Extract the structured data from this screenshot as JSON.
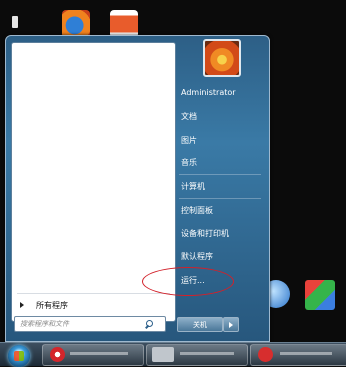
{
  "user": {
    "name": "Administrator"
  },
  "menu": {
    "right_items": [
      {
        "label": "文档"
      },
      {
        "label": "图片"
      },
      {
        "label": "音乐"
      },
      {
        "label": "计算机"
      },
      {
        "label": "控制面板"
      },
      {
        "label": "设备和打印机"
      },
      {
        "label": "默认程序"
      },
      {
        "label": "运行..."
      }
    ],
    "all_programs": "所有程序",
    "search_placeholder": "搜索程序和文件",
    "shutdown_label": "关机"
  },
  "icons": {
    "start": "windows-start-orb-icon",
    "search": "search-icon",
    "all_programs": "triangle-right-icon",
    "shutdown_arrow": "triangle-right-icon"
  },
  "colors": {
    "menu_right_bg": "#3a7aa6",
    "left_pane_bg": "#ffffff",
    "highlight": "#d2212a"
  }
}
